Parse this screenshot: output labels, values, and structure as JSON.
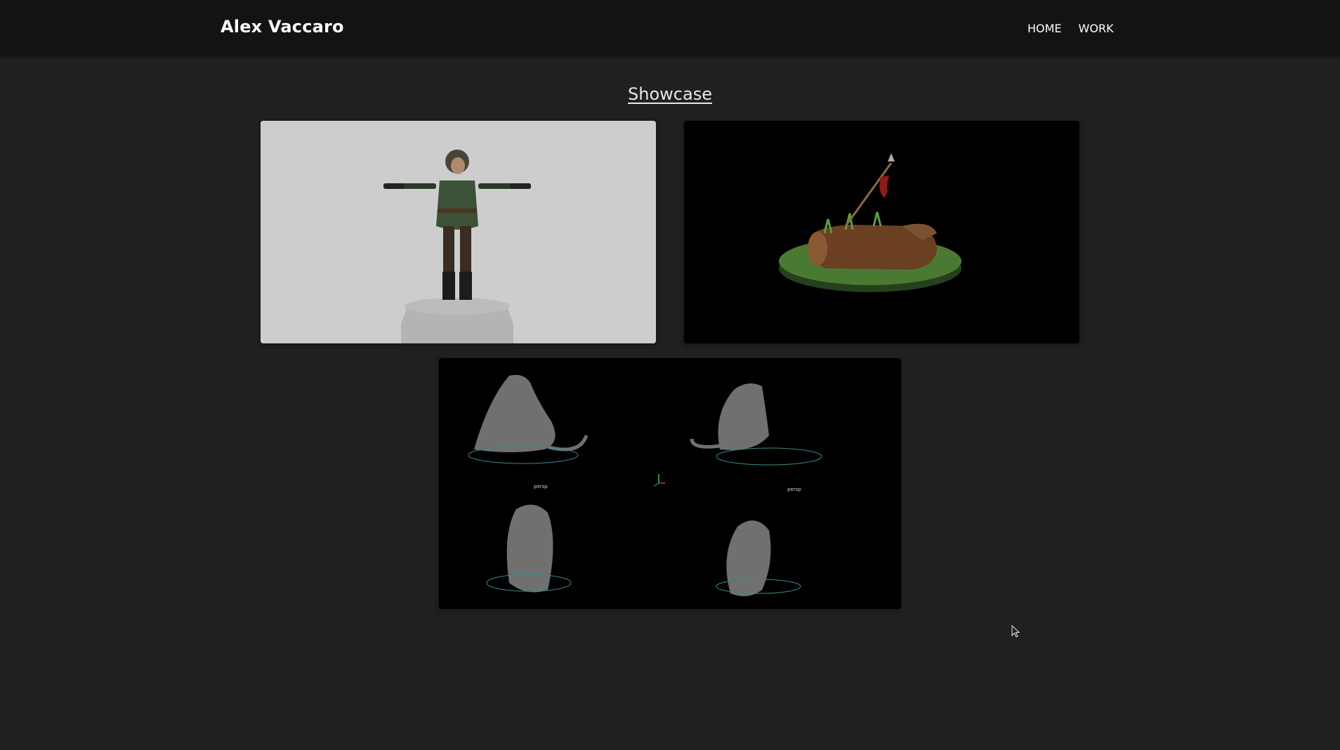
{
  "navbar": {
    "brand": "Alex Vaccaro",
    "links": [
      "HOME",
      "WORK"
    ]
  },
  "main": {
    "section_title": "Showcase",
    "viewport_labels": [
      "persp",
      "persp"
    ]
  },
  "colors": {
    "page_background": "#202020",
    "navbar_background": "#131313",
    "text": "#ffffff"
  },
  "icons": [
    "mouse-cursor-icon"
  ]
}
